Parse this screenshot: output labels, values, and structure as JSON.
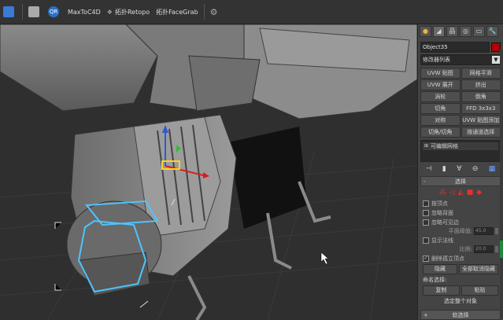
{
  "toolbar": {
    "items": [
      {
        "label": "MaxToC4D"
      },
      {
        "label": "拓扑Retopo"
      },
      {
        "label": "拓扑FaceGrab"
      }
    ],
    "qr_label": "QR"
  },
  "command_panel": {
    "tabs": [
      "●",
      "◢",
      "品",
      "◎",
      "▭",
      "🔧"
    ],
    "object_name": "Object35",
    "object_color": "#b30000",
    "modifier_list": "修改器列表",
    "modifier_buttons": [
      "UVW 贴图",
      "网格平滑",
      "UVW 展开",
      "挤出",
      "涡轮",
      "倒角",
      "切角",
      "FFD 3x3x3",
      "对称",
      "UVW 贴图添加",
      "切角/切角",
      "按通道选择"
    ],
    "stack_item": "可编辑网格",
    "selection_rollout": {
      "title": "选择",
      "checkboxes": [
        {
          "label": "按顶点",
          "checked": false
        },
        {
          "label": "忽略背面",
          "checked": false
        },
        {
          "label": "忽略可见边",
          "checked": false
        }
      ],
      "planar_threshold": {
        "label": "平面阈值:",
        "value": "45.0"
      },
      "show_normals": {
        "label": "显示法线",
        "checked": false
      },
      "scale": {
        "label": "比例:",
        "value": "20.0"
      },
      "delete_isolated": {
        "label": "删除孤立顶点",
        "checked": true
      },
      "hide_btn": "隐藏",
      "unhide_btn": "全部取消隐藏",
      "named_selections_label": "命名选择:",
      "copy_btn": "复制",
      "paste_btn": "粘贴",
      "selected_text": "选定整个对象"
    },
    "soft_selection": {
      "title": "软选择"
    },
    "scroll_color": "#1c8a3a"
  }
}
